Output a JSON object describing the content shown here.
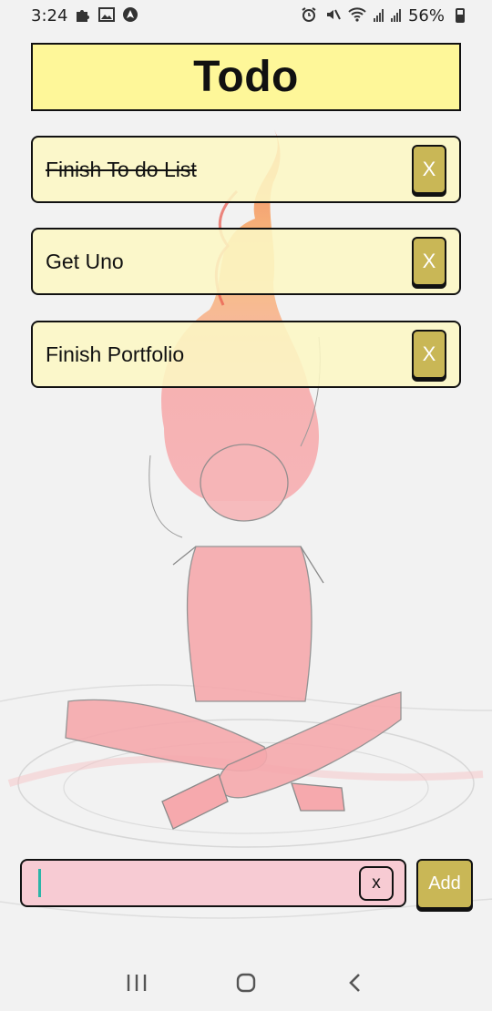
{
  "status_bar": {
    "time": "3:24",
    "battery": "56%",
    "left_icons": [
      "puzzle-icon",
      "image-icon",
      "nav-arrow-icon"
    ],
    "right_icons": [
      "alarm-icon",
      "mute-icon",
      "wifi-icon",
      "signal-icon",
      "signal-icon",
      "battery-icon"
    ]
  },
  "header": {
    "title": "Todo"
  },
  "todos": [
    {
      "text": "Finish To do List",
      "done": true,
      "delete_label": "X"
    },
    {
      "text": "Get Uno",
      "done": false,
      "delete_label": "X"
    },
    {
      "text": "Finish Portfolio",
      "done": false,
      "delete_label": "X"
    }
  ],
  "input": {
    "value": "",
    "placeholder": "",
    "clear_label": "x"
  },
  "add_button": {
    "label": "Add"
  },
  "nav": {
    "items": [
      "recents-icon",
      "home-icon",
      "back-icon"
    ]
  },
  "colors": {
    "header_bg": "#fef799",
    "todo_bg": "#fcf7c4",
    "button_bg": "#c9b756",
    "input_bg": "#f8bec8",
    "caret": "#2bb5a8"
  }
}
